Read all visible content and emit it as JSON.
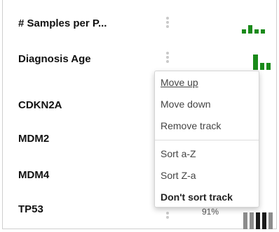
{
  "tracks": [
    {
      "label": "# Samples per P..."
    },
    {
      "label": "Diagnosis Age"
    },
    {
      "label": "CDKN2A"
    },
    {
      "label": "MDM2"
    },
    {
      "label": "MDM4"
    },
    {
      "label": "TP53",
      "percent": "91%"
    }
  ],
  "context_menu": {
    "move_up": "Move up",
    "move_down": "Move down",
    "remove_track": "Remove track",
    "sort_az": "Sort a-Z",
    "sort_za": "Sort Z-a",
    "dont_sort": "Don't sort track"
  },
  "colors": {
    "clinical_bar": "#1a8a1a",
    "genomic_bar_gray": "#8c8c8c",
    "genomic_bar_black": "#1a1a1a"
  }
}
